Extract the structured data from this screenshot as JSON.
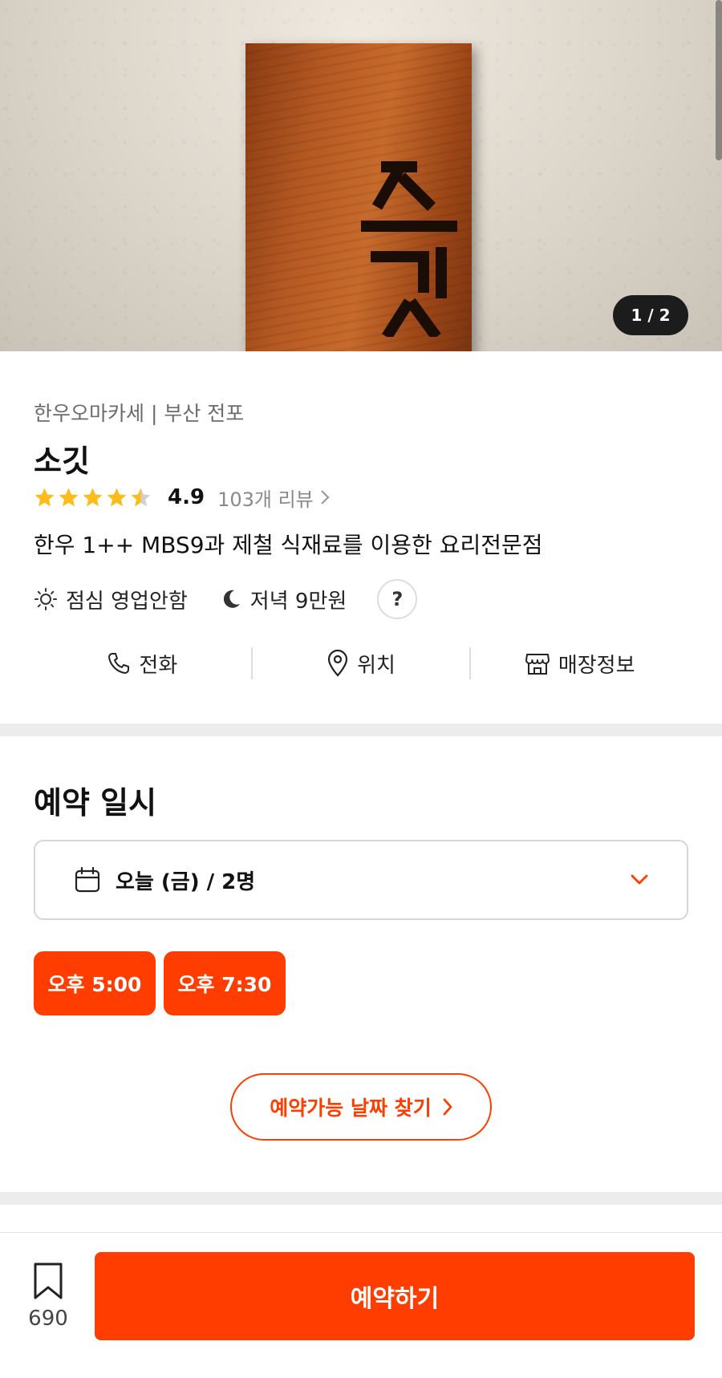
{
  "hero": {
    "pager": "1 / 2",
    "sign_glyph_text": "소깃"
  },
  "restaurant": {
    "category": "한우오마카세 | 부산 전포",
    "name": "소깃",
    "rating": "4.9",
    "rating_stars": 4.5,
    "review_link": "103개 리뷰",
    "description": "한우 1++ MBS9과 제철 식재료를 이용한 요리전문점",
    "lunch": "점심 영업안함",
    "dinner": "저녁 9만원",
    "help_label": "?"
  },
  "actions": [
    {
      "label": "전화",
      "icon": "phone-icon"
    },
    {
      "label": "위치",
      "icon": "location-pin-icon"
    },
    {
      "label": "매장정보",
      "icon": "store-icon"
    }
  ],
  "reservation": {
    "title": "예약 일시",
    "date_party": "오늘 (금) / 2명",
    "slots": [
      "오후 5:00",
      "오후 7:30"
    ],
    "find_dates": "예약가능 날짜 찾기"
  },
  "bottom": {
    "bookmark_count": "690",
    "reserve_label": "예약하기"
  },
  "colors": {
    "accent": "#ff3d00",
    "star": "#fbbc1c",
    "star_empty": "#cfcfcf"
  }
}
